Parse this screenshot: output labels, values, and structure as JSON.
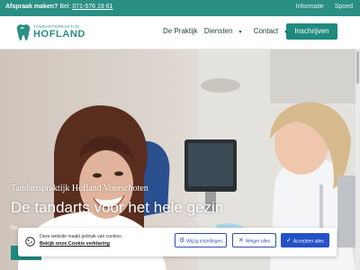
{
  "topbar": {
    "prompt": "Afspraak maken?",
    "phone_label": "Bel:",
    "phone": "071-576 19 61",
    "links": [
      "Informatie",
      "Spoed"
    ]
  },
  "logo": {
    "small": "TANDARTSPRAKTIJK",
    "big": "HOFLAND",
    "icon": "tooth-icon"
  },
  "nav": {
    "items": [
      {
        "label": "De Praktijk",
        "dropdown": false
      },
      {
        "label": "Diensten",
        "dropdown": true
      },
      {
        "label": "Contact",
        "dropdown": true
      }
    ],
    "language_icon": "uk-flag-icon",
    "cta_label": "Inschrijven"
  },
  "hero": {
    "subtitle": "Tandartspraktijk Hofland Voorschoten",
    "title": "De tandarts voor het hele gezin",
    "fragment": "Ro"
  },
  "cookie": {
    "text": "Deze website maakt gebruik van cookies.",
    "link": "Bekijk onze Cookie verklaring",
    "prefs_label": "Wijzig instellingen",
    "reject_label": "Weiger alles",
    "accept_label": "Accepteer alles",
    "icons": [
      "cookie-icon",
      "gear-icon",
      "close-icon",
      "check-icon"
    ]
  },
  "colors": {
    "brand": "#2a8f84",
    "cta": "#1f8a7d",
    "accept": "#2451c7",
    "outline": "#2f4cb3"
  }
}
